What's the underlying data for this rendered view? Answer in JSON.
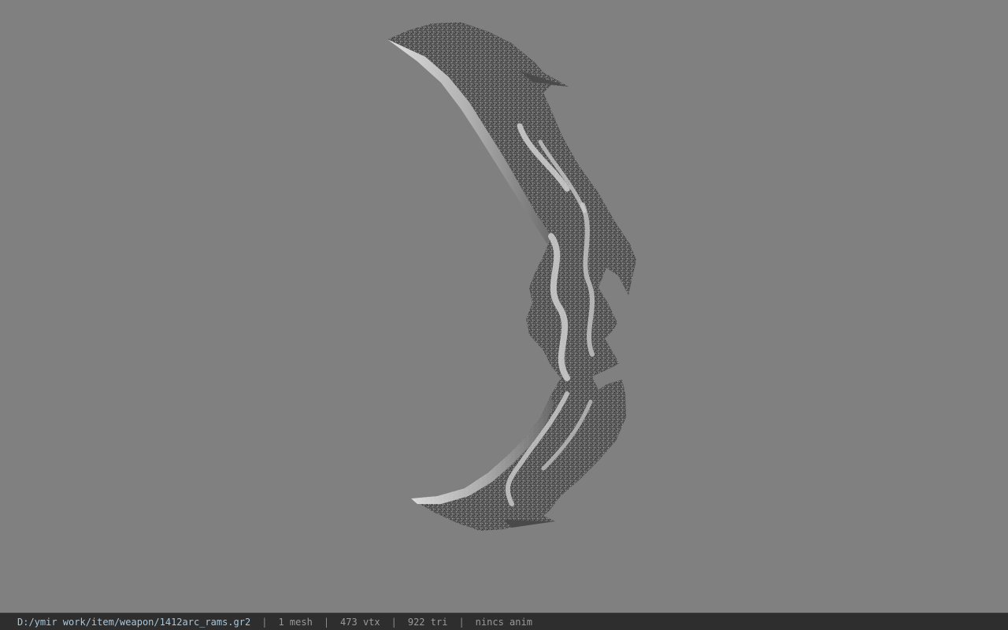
{
  "viewport": {
    "background_color": "#808080",
    "model_name": "bow-model"
  },
  "status_bar": {
    "file_path": "D:/ymir work/item/weapon/1412arc_rams.gr2",
    "separator": "|",
    "mesh_count": "1 mesh",
    "vertex_count": "473 vtx",
    "triangle_count": "922 tri",
    "anim_status": "nincs anim",
    "path_color": "#a7c7de",
    "text_color": "#9a9a9a"
  }
}
